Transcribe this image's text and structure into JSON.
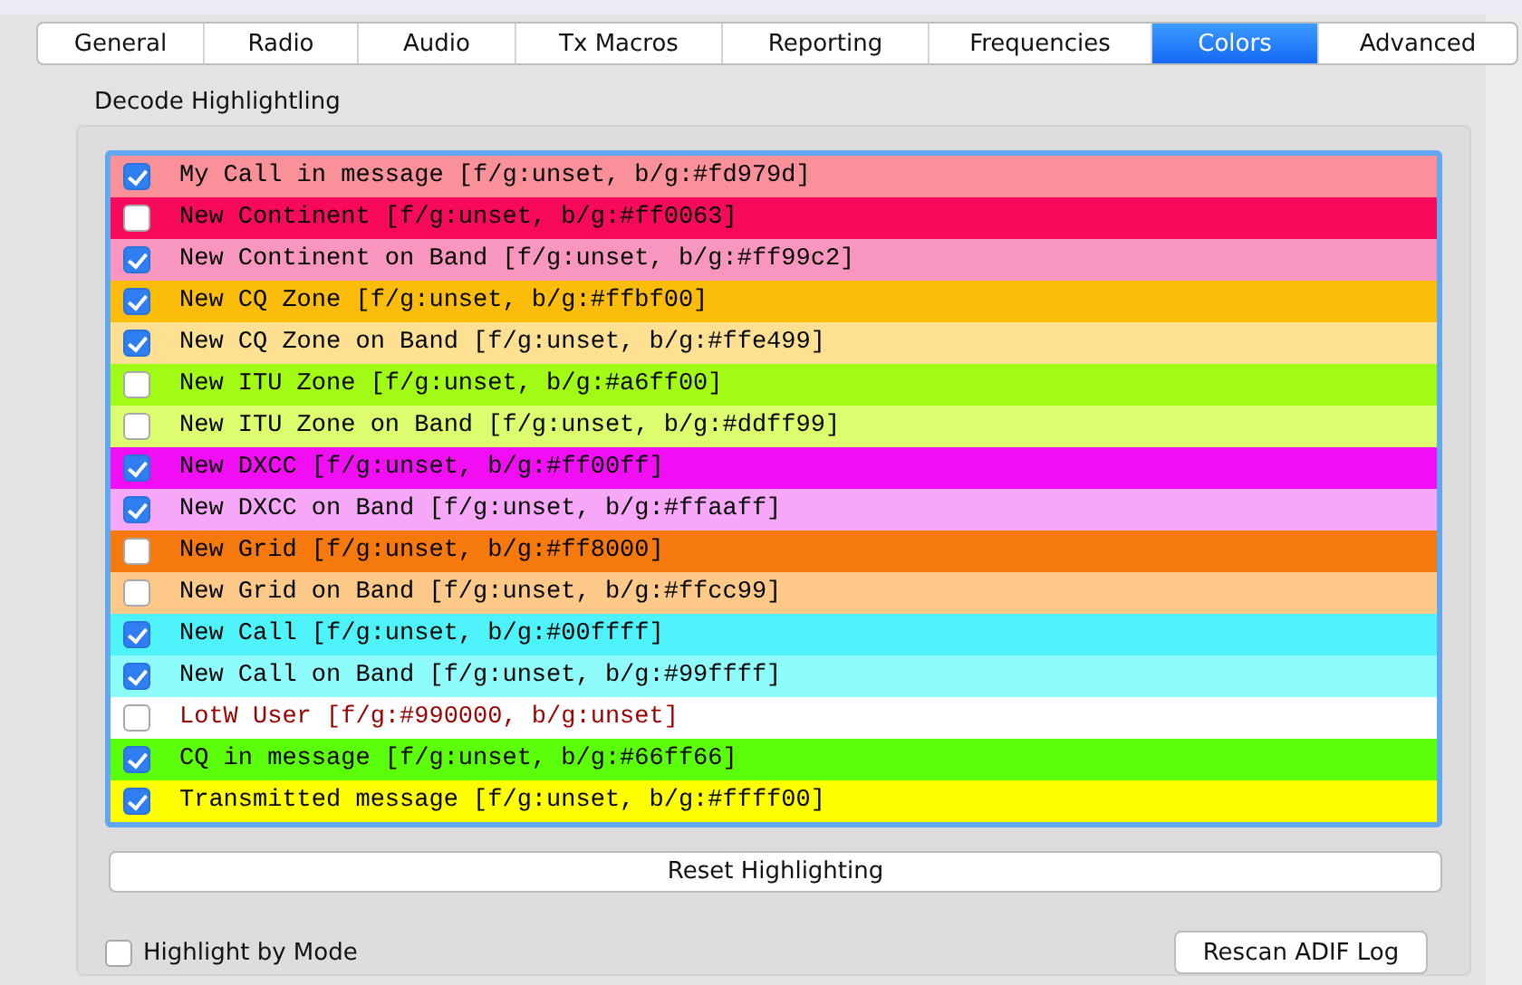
{
  "tabs": [
    {
      "label": "General",
      "selected": false
    },
    {
      "label": "Radio",
      "selected": false
    },
    {
      "label": "Audio",
      "selected": false
    },
    {
      "label": "Tx Macros",
      "selected": false
    },
    {
      "label": "Reporting",
      "selected": false
    },
    {
      "label": "Frequencies",
      "selected": false
    },
    {
      "label": "Colors",
      "selected": true
    },
    {
      "label": "Advanced",
      "selected": false
    }
  ],
  "group": {
    "title": "Decode Highlightling",
    "items": [
      {
        "label": "My Call in message [f/g:unset, b/g:#fd979d]",
        "checked": true,
        "color": "#fa9199",
        "kind": "background"
      },
      {
        "label": "New Continent [f/g:unset, b/g:#ff0063]",
        "checked": false,
        "color": "#f70a5c",
        "kind": "background"
      },
      {
        "label": "New Continent on Band [f/g:unset, b/g:#ff99c2]",
        "checked": true,
        "color": "#f996c0",
        "kind": "background"
      },
      {
        "label": "New CQ Zone [f/g:unset, b/g:#ffbf00]",
        "checked": true,
        "color": "#fbbc0a",
        "kind": "background"
      },
      {
        "label": "New CQ Zone on Band [f/g:unset, b/g:#ffe499]",
        "checked": true,
        "color": "#fde092",
        "kind": "background"
      },
      {
        "label": "New ITU Zone [f/g:unset, b/g:#a6ff00]",
        "checked": false,
        "color": "#a2fb14",
        "kind": "background"
      },
      {
        "label": "New ITU Zone on Band [f/g:unset, b/g:#ddff99]",
        "checked": false,
        "color": "#dcfd6e",
        "kind": "background"
      },
      {
        "label": "New DXCC [f/g:unset, b/g:#ff00ff]",
        "checked": true,
        "color": "#f20ef2",
        "kind": "background"
      },
      {
        "label": "New DXCC on Band [f/g:unset, b/g:#ffaaff]",
        "checked": true,
        "color": "#f7a7f7",
        "kind": "background"
      },
      {
        "label": "New Grid [f/g:unset, b/g:#ff8000]",
        "checked": false,
        "color": "#f5790c",
        "kind": "background"
      },
      {
        "label": "New Grid on Band [f/g:unset, b/g:#ffcc99]",
        "checked": false,
        "color": "#fdc989",
        "kind": "background"
      },
      {
        "label": "New Call [f/g:unset, b/g:#00ffff]",
        "checked": true,
        "color": "#4df3f9",
        "kind": "background"
      },
      {
        "label": "New Call on Band [f/g:unset, b/g:#99ffff]",
        "checked": true,
        "color": "#8ffcfc",
        "kind": "background"
      },
      {
        "label": "LotW User [f/g:#990000, b/g:unset]",
        "checked": false,
        "color": "#990000",
        "kind": "foreground"
      },
      {
        "label": "CQ in message [f/g:unset, b/g:#66ff66]",
        "checked": true,
        "color": "#5cff0a",
        "kind": "background"
      },
      {
        "label": "Transmitted message [f/g:unset, b/g:#ffff00]",
        "checked": true,
        "color": "#ffff00",
        "kind": "background"
      }
    ],
    "reset_button": "Reset Highlighting",
    "highlight_by_mode": {
      "label": "Highlight by Mode",
      "checked": false
    },
    "rescan_button": "Rescan ADIF Log"
  }
}
